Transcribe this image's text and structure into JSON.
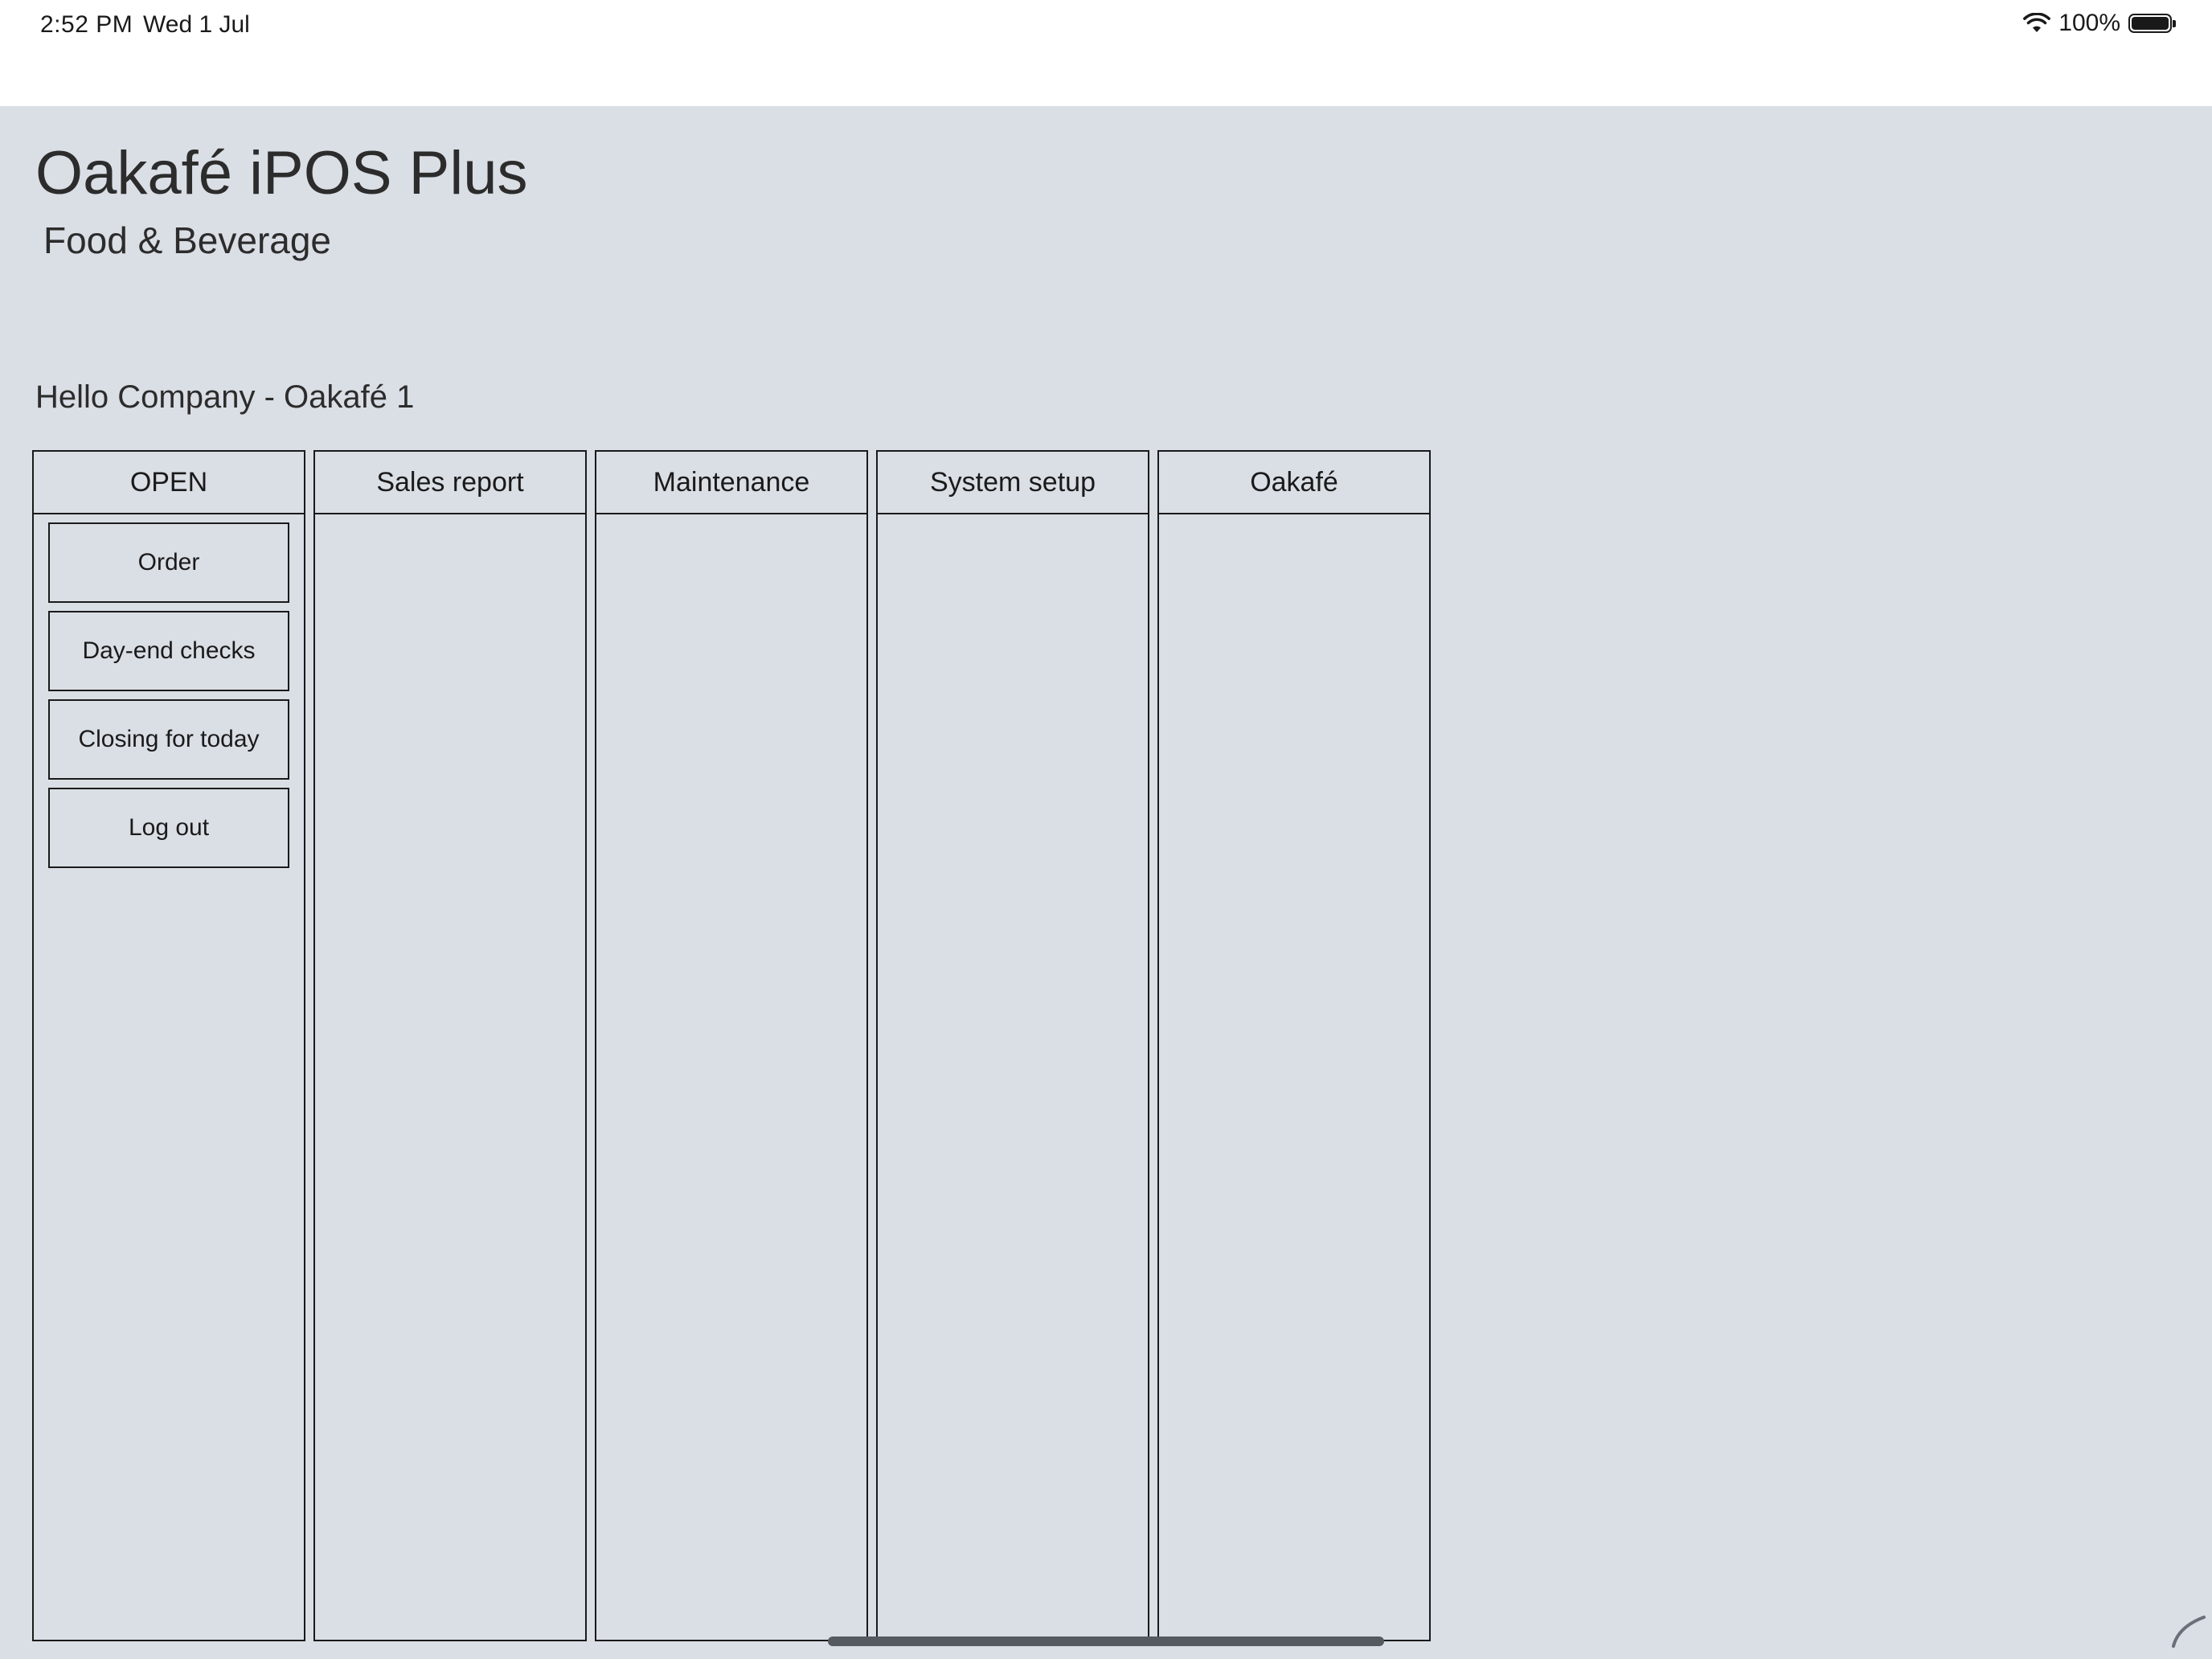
{
  "status_bar": {
    "time": "2:52 PM",
    "date": "Wed 1 Jul",
    "battery_text": "100%",
    "battery_level": 1.0,
    "wifi_icon": "wifi-icon",
    "battery_icon": "battery-icon"
  },
  "app": {
    "title": "Oakafé iPOS Plus",
    "subtitle": "Food & Beverage",
    "greeting": "Hello Company - Oakafé 1"
  },
  "columns": [
    {
      "header": "OPEN",
      "buttons": [
        {
          "label": "Order"
        },
        {
          "label": "Day-end checks"
        },
        {
          "label": "Closing for today"
        },
        {
          "label": "Log out"
        }
      ]
    },
    {
      "header": "Sales report",
      "buttons": []
    },
    {
      "header": "Maintenance",
      "buttons": []
    },
    {
      "header": "System setup",
      "buttons": []
    },
    {
      "header": "Oakafé",
      "buttons": []
    }
  ],
  "colors": {
    "background": "#dadee5",
    "border": "#1a1a1a",
    "status_bar": "#ffffff"
  }
}
